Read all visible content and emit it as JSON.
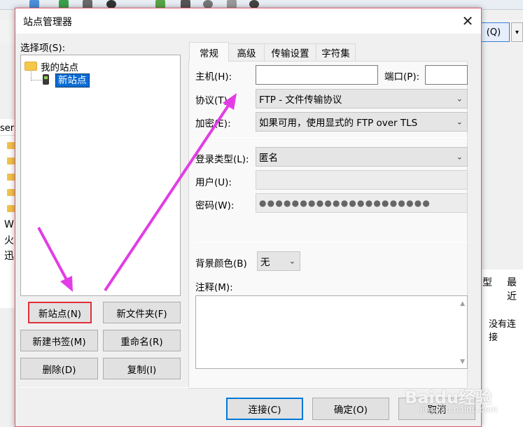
{
  "background_app": {
    "search_button_label": "(Q)",
    "dropdown_glyph": "▾",
    "user_cell_text": "sers",
    "left_texts": [
      "W",
      "火",
      "迅"
    ],
    "column_headers": [
      "型",
      "最近"
    ],
    "no_connection_text": "没有连接"
  },
  "dialog": {
    "title": "站点管理器",
    "close_glyph": "✕",
    "select_entry_label": "选择项(S):",
    "tree": {
      "root_label": "我的站点",
      "site_label": "新站点"
    },
    "left_buttons": {
      "new_site": "新站点(N)",
      "new_folder": "新文件夹(F)",
      "new_bookmark": "新建书签(M)",
      "rename": "重命名(R)",
      "delete": "删除(D)",
      "copy": "复制(I)"
    },
    "tabs": [
      "常规",
      "高级",
      "传输设置",
      "字符集"
    ],
    "general": {
      "host_label": "主机(H):",
      "host_value": "",
      "port_label": "端口(P):",
      "port_value": "",
      "protocol_label": "协议(T):",
      "protocol_value": "FTP - 文件传输协议",
      "encryption_label": "加密(E):",
      "encryption_value": "如果可用，使用显式的 FTP over TLS",
      "logon_type_label": "登录类型(L):",
      "logon_type_value": "匿名",
      "user_label": "用户(U):",
      "password_label": "密码(W):",
      "password_value": "●●●●●●●●●●●●●●●●●●●●●",
      "bg_color_label": "背景颜色(B)",
      "bg_color_value": "无",
      "comments_label": "注释(M):"
    },
    "footer_buttons": {
      "connect": "连接(C)",
      "ok": "确定(O)",
      "cancel": "取消"
    },
    "combo_arrow": "⌄"
  },
  "annotation": {
    "arrow_color": "#e33ce6",
    "highlight_color": "#e0303a"
  },
  "watermark": {
    "main": "Baidu经验",
    "sub": "jingyan.baidu.com"
  }
}
